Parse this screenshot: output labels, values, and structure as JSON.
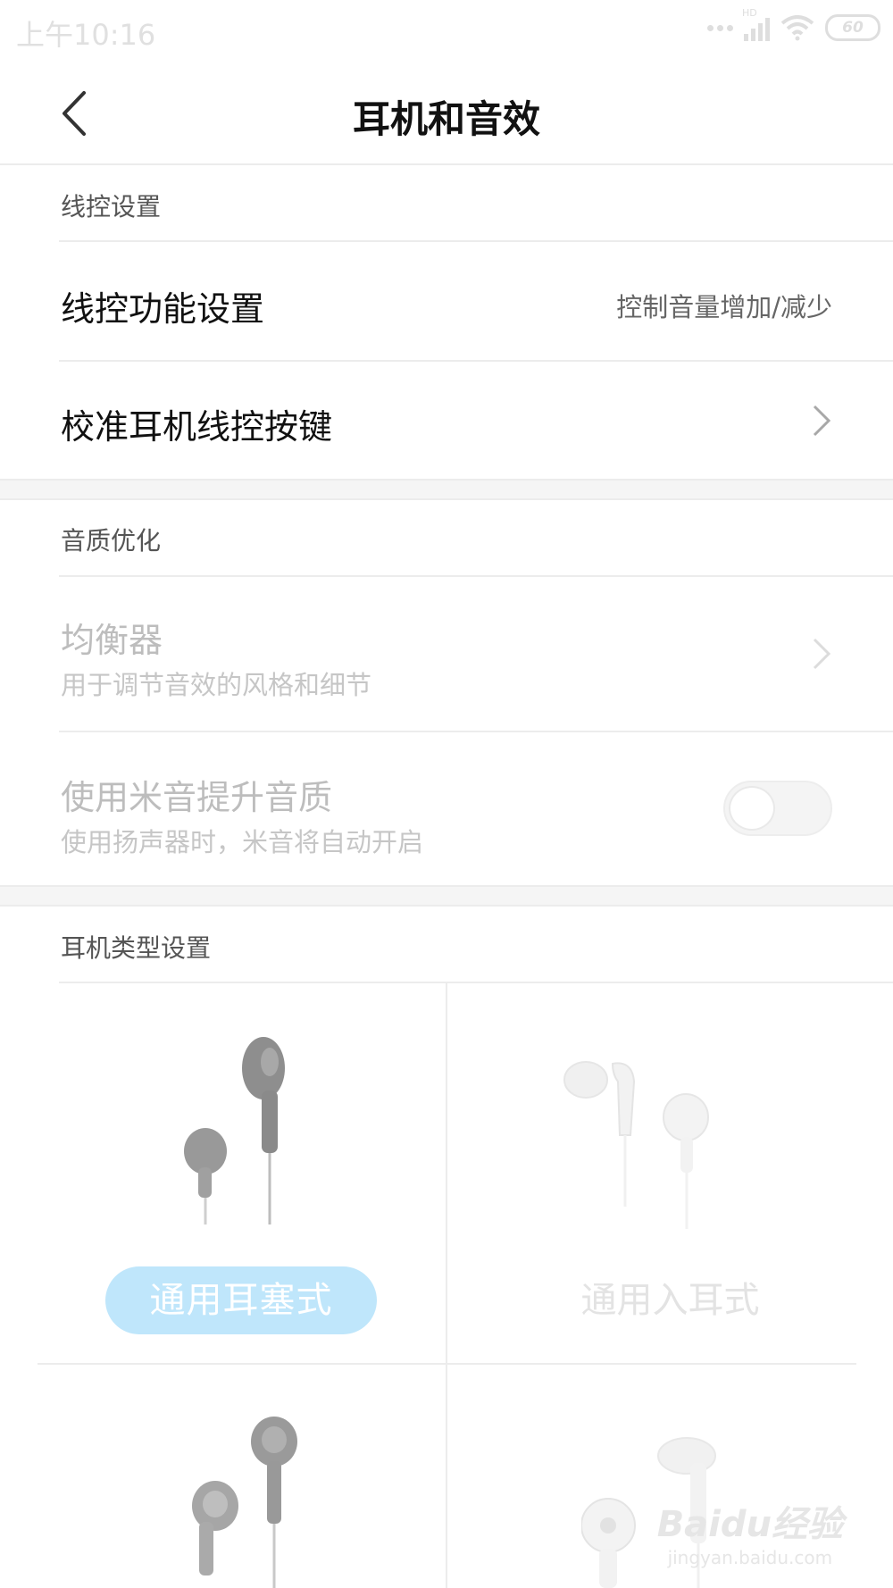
{
  "status_bar": {
    "time": "上午10:16",
    "network_badge": "HD",
    "battery_level": "60",
    "icons": [
      "dots-icon",
      "signal-icon",
      "wifi-icon",
      "battery-icon"
    ]
  },
  "header": {
    "title": "耳机和音效",
    "back_icon": "chevron-left-icon"
  },
  "line_control": {
    "section_title": "线控设置",
    "function_label": "线控功能设置",
    "function_value": "控制音量增加/减少",
    "calibrate_label": "校准耳机线控按键"
  },
  "sound_quality": {
    "section_title": "音质优化",
    "equalizer_label": "均衡器",
    "equalizer_sub": "用于调节音效的风格和细节",
    "miyin_label": "使用米音提升音质",
    "miyin_sub": "使用扬声器时，米音将自动开启",
    "miyin_enabled": false
  },
  "earphone_type": {
    "section_title": "耳机类型设置",
    "types": [
      {
        "label": "通用耳塞式",
        "selected": true
      },
      {
        "label": "通用入耳式",
        "selected": false
      }
    ]
  },
  "watermark": {
    "brand": "Baidu经验",
    "url": "jingyan.baidu.com"
  },
  "colors": {
    "accent_pill": "#bfe6fb",
    "divider": "#ececec",
    "disabled_text": "#bdbdbd"
  }
}
